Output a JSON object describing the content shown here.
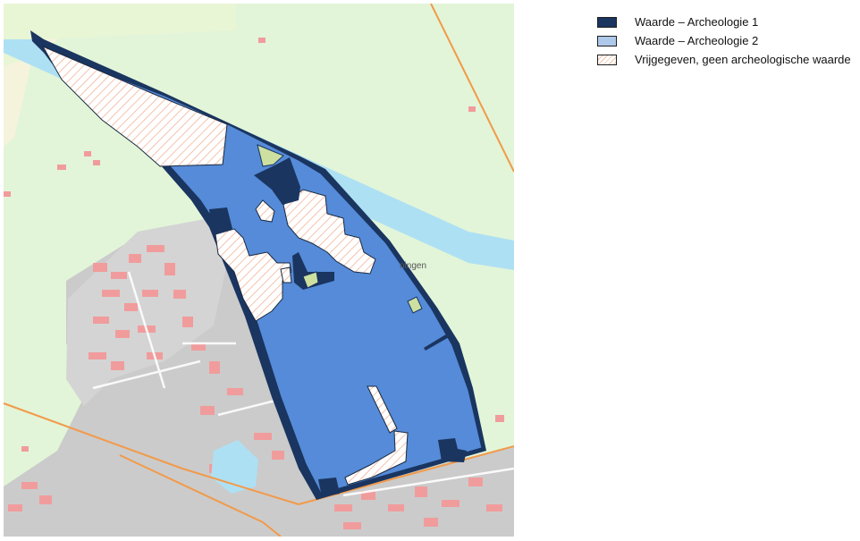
{
  "map": {
    "place_label": "ningen",
    "colors": {
      "waarde_1": "#1a3560",
      "waarde_2": "#558bd8",
      "hatch_line": "#f0b49a",
      "water": "#aee0f4",
      "grassland": "#e2f5d8",
      "urban": "#cbcbcb",
      "buildings": "#f19c9c",
      "road": "#f29a4a",
      "highlight": "#cde0a0"
    }
  },
  "legend": {
    "items": [
      {
        "label": "Waarde – Archeologie 1",
        "fill": "#1a3560"
      },
      {
        "label": "Waarde – Archeologie 2",
        "fill": "#aec8ea"
      },
      {
        "label": "Vrijgegeven, geen archeologische waarde",
        "fill": "hatched"
      }
    ]
  }
}
